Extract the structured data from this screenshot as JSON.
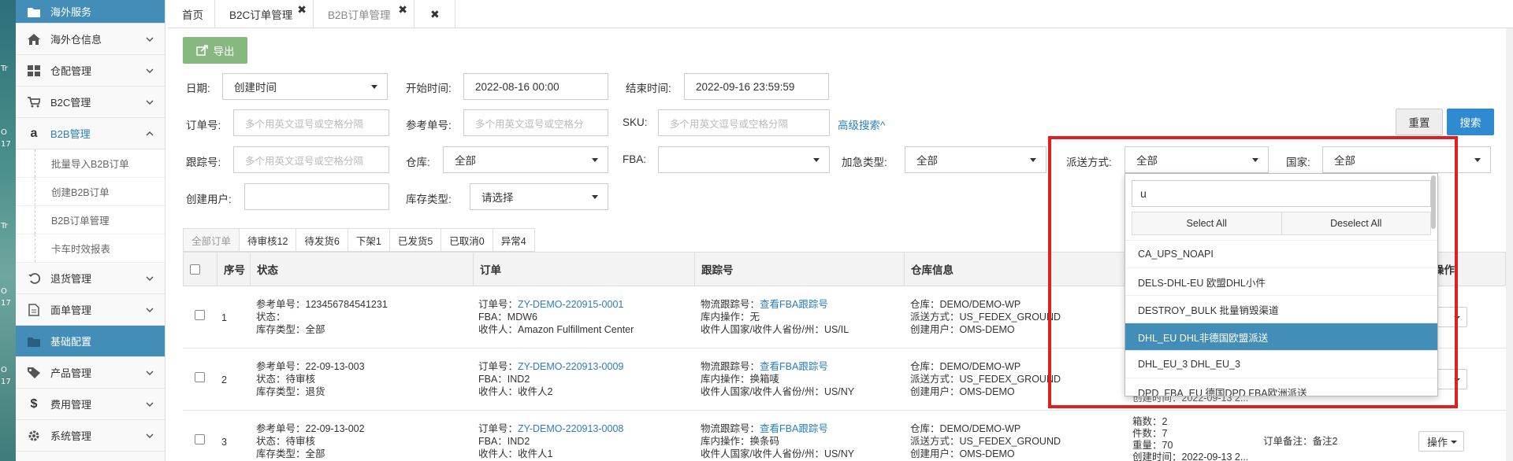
{
  "desktop": {
    "labels": [
      "Tr",
      "O",
      "17",
      "Tr",
      "O",
      "17",
      "O",
      "17"
    ]
  },
  "sidebar": {
    "items": [
      {
        "label": "海外服务",
        "icon": "folder-icon",
        "state": "active"
      },
      {
        "label": "海外仓信息",
        "icon": "home-icon",
        "state": ""
      },
      {
        "label": "仓配管理",
        "icon": "grid-icon",
        "state": ""
      },
      {
        "label": "B2C管理",
        "icon": "cart-icon",
        "state": ""
      },
      {
        "label": "B2B管理",
        "icon": "amazon-icon",
        "state": "open"
      }
    ],
    "sub_items": [
      "批量导入B2B订单",
      "创建B2B订单",
      "B2B订单管理",
      "卡车时效报表"
    ],
    "items2": [
      {
        "label": "退货管理",
        "icon": "undo-icon",
        "state": ""
      },
      {
        "label": "面单管理",
        "icon": "file-icon",
        "state": ""
      },
      {
        "label": "基础配置",
        "icon": "folder-icon",
        "state": "active"
      },
      {
        "label": "产品管理",
        "icon": "tag-icon",
        "state": ""
      },
      {
        "label": "费用管理",
        "icon": "dollar-icon",
        "state": ""
      },
      {
        "label": "系统管理",
        "icon": "gear-icon",
        "state": ""
      }
    ]
  },
  "tabs": [
    {
      "label": "首页",
      "closable": false
    },
    {
      "label": "B2C订单管理",
      "closable": true
    },
    {
      "label": "B2B订单管理",
      "closable": true
    },
    {
      "label": "",
      "closable": true
    }
  ],
  "toolbar": {
    "export_label": "导出"
  },
  "form": {
    "date_label": "日期:",
    "date_value": "创建时间",
    "start_label": "开始时间:",
    "start_value": "2022-08-16 00:00",
    "end_label": "结束时间:",
    "end_value": "2022-09-16 23:59:59",
    "order_label": "订单号:",
    "order_placeholder": "多个用英文逗号或空格分隔",
    "ref_label": "参考单号:",
    "ref_placeholder": "多个用英文逗号或空格分",
    "sku_label": "SKU:",
    "sku_placeholder": "多个用英文逗号或空格分隔",
    "advanced_label": "高级搜索^",
    "reset_label": "重置",
    "search_label": "搜索",
    "track_label": "跟踪号:",
    "track_placeholder": "多个用英文逗号或空格分隔",
    "warehouse_label": "仓库:",
    "warehouse_value": "全部",
    "fba_label": "FBA:",
    "fba_value": "",
    "urgent_label": "加急类型:",
    "urgent_value": "全部",
    "delivery_label": "派送方式:",
    "delivery_value": "全部",
    "country_label": "国家:",
    "country_value": "全部",
    "user_label": "创建用户:",
    "user_value": "",
    "stock_label": "库存类型:",
    "stock_value": "请选择"
  },
  "filter_tabs": [
    "全部订单",
    "待审核12",
    "待发货6",
    "下架1",
    "已发货5",
    "已取消0",
    "异常4"
  ],
  "table": {
    "headers": [
      "",
      "序号",
      "状态",
      "订单",
      "跟踪号",
      "仓库信息",
      "",
      "",
      "操作"
    ],
    "rows": [
      {
        "no": "1",
        "status": [
          "参考单号：123456784541231",
          "状态：",
          "库存类型：全部"
        ],
        "order_prefix": "订单号：",
        "order_no": "ZY-DEMO-220915-0001",
        "order_lines": [
          "FBA：MDW6",
          "收件人：Amazon Fulfillment Center"
        ],
        "track_prefix": "物流跟踪号：",
        "track_link": "查看FBA跟踪号",
        "track_lines": [
          "库内操作：无",
          "收件人国家/收件人省份/州：US/IL"
        ],
        "wh": [
          "仓库：DEMO/DEMO-WP",
          "派送方式：US_FEDEX_GROUND",
          "创建用户：OMS-DEMO"
        ],
        "op": "作"
      },
      {
        "no": "2",
        "status": [
          "参考单号：22-09-13-003",
          "状态：待审核",
          "库存类型：退货"
        ],
        "order_prefix": "订单号：",
        "order_no": "ZY-DEMO-220913-0009",
        "order_lines": [
          "FBA：IND2",
          "收件人：收件人2"
        ],
        "track_prefix": "物流跟踪号：",
        "track_link": "查看FBA跟踪号",
        "track_lines": [
          "库内操作：换箱唛",
          "收件人国家/收件人省份/州：US/NY"
        ],
        "wh": [
          "仓库：DEMO/DEMO-WP",
          "派送方式：US_FEDEX_GROUND",
          "创建用户：OMS-DEMO"
        ],
        "extra": [
          "创建时间：2022-09-13 2..."
        ],
        "op": "作"
      },
      {
        "no": "3",
        "status": [
          "参考单号：22-09-13-002",
          "状态：待审核",
          "库存类型：全部"
        ],
        "order_prefix": "订单号：",
        "order_no": "ZY-DEMO-220913-0008",
        "order_lines": [
          "FBA：IND2",
          "收件人：收件人1"
        ],
        "track_prefix": "物流跟踪号：",
        "track_link": "查看FBA跟踪号",
        "track_lines": [
          "库内操作：换条码",
          "收件人国家/收件人省份/州：US/NY"
        ],
        "wh": [
          "仓库：DEMO/DEMO-WP",
          "派送方式：US_FEDEX_GROUND",
          "创建用户：OMS-DEMO"
        ],
        "extra": [
          "箱数：2",
          "件数：7",
          "重量：70",
          "创建时间：2022-09-13 2..."
        ],
        "remark": "订单备注：备注2",
        "op": "操作"
      }
    ]
  },
  "dropdown": {
    "search_value": "u",
    "select_all": "Select All",
    "deselect_all": "Deselect All",
    "options": [
      "CA_UPS_NOAPI",
      "DELS-DHL-EU 欧盟DHL小件",
      "DESTROY_BULK 批量销毁渠道",
      "DHL_EU DHL非德国欧盟派送",
      "DHL_EU_3 DHL_EU_3",
      "DPD_FBA_EU 德国DPD FBA欧洲派送"
    ],
    "highlighted_index": 3
  }
}
